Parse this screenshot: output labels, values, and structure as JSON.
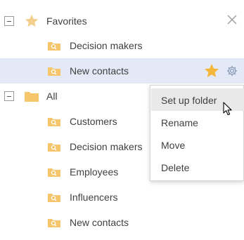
{
  "tree": {
    "favorites": {
      "label": "Favorites",
      "icon": "star-icon",
      "close_icon": "close-icon",
      "items": [
        {
          "label": "Decision makers",
          "icon": "search-folder-icon"
        },
        {
          "label": "New contacts",
          "icon": "search-folder-icon",
          "selected": true,
          "action_icons": [
            "star-icon",
            "gear-icon"
          ]
        }
      ]
    },
    "all": {
      "label": "All",
      "icon": "folder-icon",
      "items": [
        {
          "label": "Customers",
          "icon": "search-folder-icon"
        },
        {
          "label": "Decision makers",
          "icon": "search-folder-icon"
        },
        {
          "label": "Employees",
          "icon": "search-folder-icon"
        },
        {
          "label": "Influencers",
          "icon": "search-folder-icon"
        },
        {
          "label": "New contacts",
          "icon": "search-folder-icon"
        }
      ]
    }
  },
  "context_menu": {
    "items": [
      {
        "label": "Set up folder",
        "highlighted": true
      },
      {
        "label": "Rename"
      },
      {
        "label": "Move"
      },
      {
        "label": "Delete"
      }
    ]
  },
  "colors": {
    "selected_row_bg": "#e3e9f6",
    "folder": "#f5c66b",
    "star_outline": "#f3cf8c",
    "star_filled": "#f5b73a",
    "text": "#404040"
  }
}
